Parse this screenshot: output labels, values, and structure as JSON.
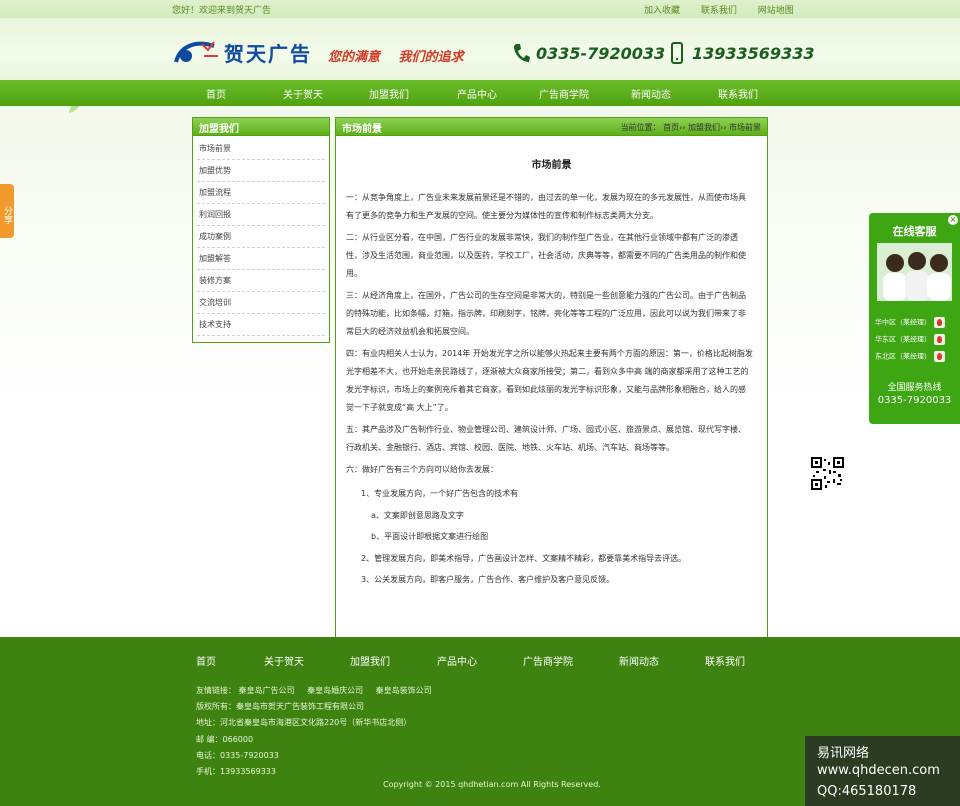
{
  "topbar": {
    "welcome": "您好！欢迎来到贺天广告",
    "links": [
      "加入收藏",
      "联系我们",
      "网站地图"
    ]
  },
  "header": {
    "logo_text": "贺天广告",
    "slogan_1": "您的满意",
    "slogan_2": "我们的追求",
    "phone_1": "0335-7920033",
    "phone_2": "13933569333"
  },
  "nav": {
    "items": [
      "首页",
      "关于贺天",
      "加盟我们",
      "产品中心",
      "广告商学院",
      "新闻动态",
      "联系我们"
    ]
  },
  "sidebar": {
    "title": "加盟我们",
    "items": [
      "市场前景",
      "加盟优势",
      "加盟流程",
      "利润回报",
      "成功案例",
      "加盟解答",
      "装修方案",
      "交流培训",
      "技术支持"
    ]
  },
  "main": {
    "section_title": "市场前景",
    "breadcrumb": "当前位置： 首页›› 加盟我们›› 市场前景",
    "article_title": "市场前景",
    "paragraphs": [
      "一：从竞争角度上，广告业未来发展前景还是不错的，由过去的单一化，发展为现在的多元发展性，从而使市场具有了更多的竞争力和生产发展的空间。使主要分为媒体性的宣传和制作标志类两大分支。",
      "二：从行业区分看，在中国，广告行业的发展非常快，我们的制作型广告业，在其他行业领域中都有广泛的渗透性，涉及生活范围，商业范围，以及医药，学校工厂，社会活动，庆典等等，都需要不同的广告类用品的制作和使用。",
      "三：从经济角度上，在国外，广告公司的生存空间是非常大的，特别是一些创意能力强的广告公司。由于广告制品的特殊功能，比如条幅，灯箱，指示牌，印刷刻字，铭牌，亮化等等工程的广泛应用，因此可以说为我们带来了非常巨大的经济效益机会和拓展空间。",
      "四：有业内相关人士认为，2014年 开始发光字之所以能够火热起来主要有两个方面的原因：第一，价格比起树脂发光字相差不大，也开始走亲民路线了，逐渐被大众商家所接受；第二，看到众多中高 端的商家都采用了这种工艺的发光字标识，市场上的案例充斥着其它商家，看到如此炫丽的发光字标识形象，又能与品牌形象相融合，给人的感觉一下子就变成“高 大上”了。",
      "五：其产品涉及广告制作行业、物业管理公司、建筑设计师、广场、园式小区、旅游景点、展览馆、现代写字楼、行政机关、金融银行、酒店、宾馆、校园、医院、地铁、火车站、机场、汽车站、商场等等。",
      "六：做好广告有三个方向可以给你去发展："
    ],
    "sub_items": [
      {
        "text": "1、专业发展方向，一个好广告包含的技术有",
        "level": 1
      },
      {
        "text": "a、文案即创意思路及文字",
        "level": 2
      },
      {
        "text": "b、平面设计即根据文案进行绘图",
        "level": 2
      },
      {
        "text": "2、管理发展方向，即美术指导，广告画设计怎样、文案精不精彩，都要靠美术指导去评选。",
        "level": 1
      },
      {
        "text": "3、公关发展方向，即客户服务，广告合作、客户维护及客户意见反馈。",
        "level": 1
      }
    ]
  },
  "footer": {
    "nav": [
      "首页",
      "关于贺天",
      "加盟我们",
      "产品中心",
      "广告商学院",
      "新闻动态",
      "联系我们"
    ],
    "links_label": "友情链接：",
    "links": [
      "秦皇岛广告公司",
      "秦皇岛婚庆公司",
      "秦皇岛装饰公司"
    ],
    "copyright_owner": "版权所有：秦皇岛市贺天广告装饰工程有限公司",
    "address": "地址：河北省秦皇岛市海港区文化路220号（新华书店北侧）",
    "postcode": "邮 编：066000",
    "tel": "电话：0335-7920033",
    "mobile": "手机：13933569333",
    "copyright": "Copyright © 2015 qhdhetian.com All Rights Reserved."
  },
  "share": {
    "label": "分享"
  },
  "service": {
    "title": "在线客服",
    "contacts": [
      "华中区（某经理）",
      "华东区（某经理）",
      "东北区（某经理）"
    ],
    "hotline_label": "全国服务热线",
    "hotline": "0335-7920033"
  },
  "watermark": {
    "line1": "易讯网络",
    "line2": "www.qhdecen.com",
    "line3": "QQ:465180178"
  },
  "colors": {
    "nav_green": "#4fa10f",
    "footer_green": "#3e8310",
    "service_green": "#3da612",
    "share_orange": "#f39a2c"
  }
}
